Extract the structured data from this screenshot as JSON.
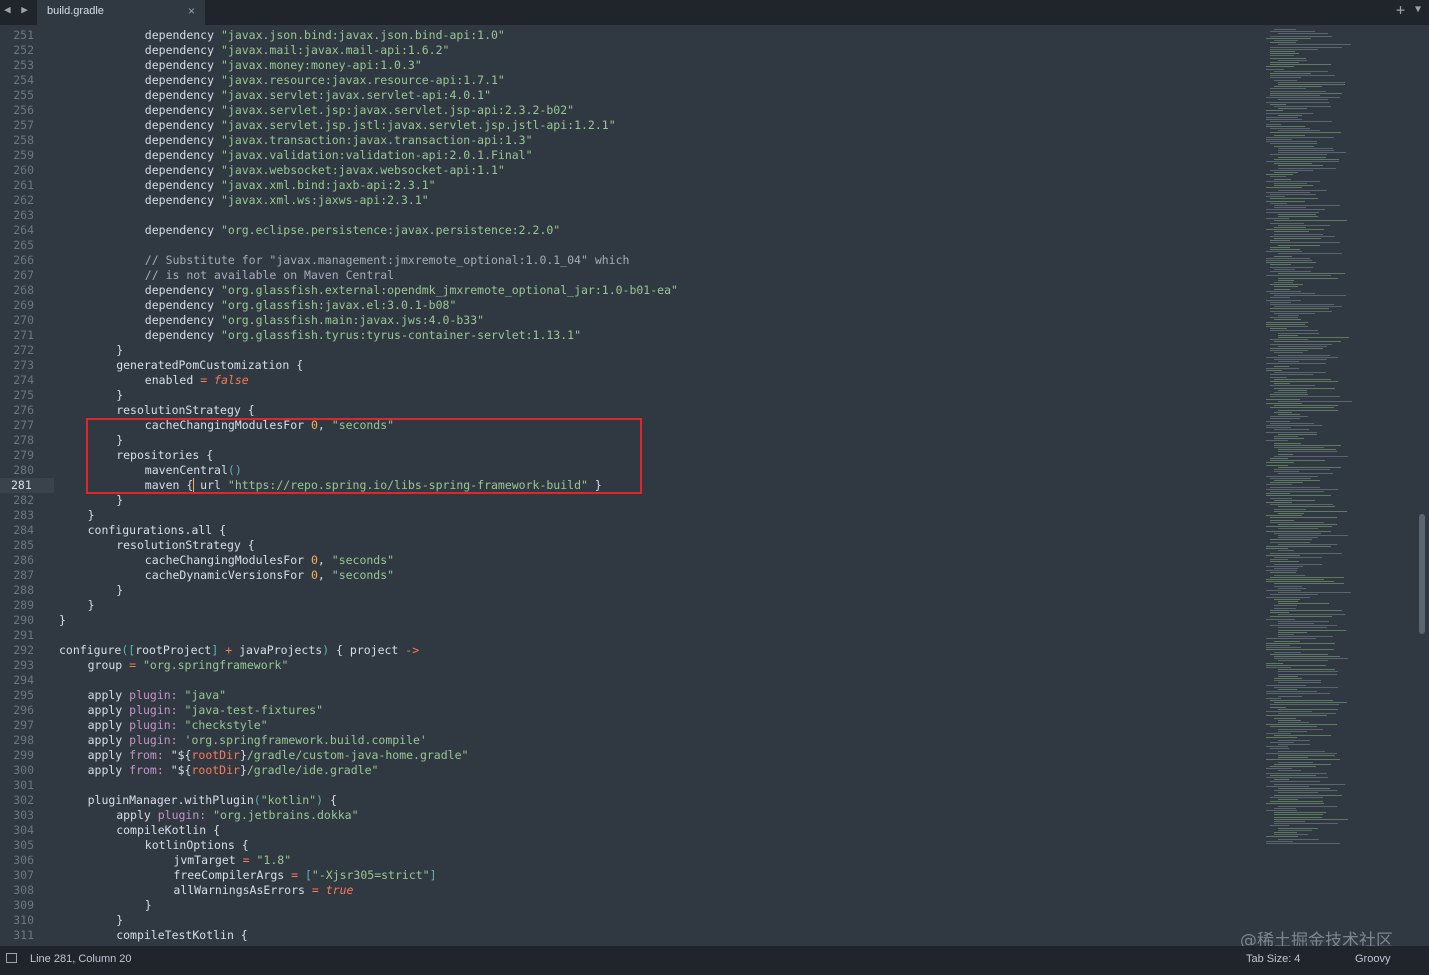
{
  "tab": {
    "filename": "build.gradle",
    "close": "×"
  },
  "tabbar": {
    "nav": "◀ ▶",
    "new_tab": "+",
    "menu": "▼"
  },
  "status": {
    "position": "Line 281, Column 20",
    "tab_size": "Tab Size: 4",
    "syntax": "Groovy"
  },
  "watermark": "@稀土掘金技术社区",
  "editor": {
    "active_line": 281,
    "first_line": 251,
    "lines": [
      [
        [
          4,
          ""
        ],
        [
          "t",
          "dependency "
        ],
        [
          "s",
          "\"javax.json.bind:javax.json.bind-api:1.0\""
        ]
      ],
      [
        [
          4,
          ""
        ],
        [
          "t",
          "dependency "
        ],
        [
          "s",
          "\"javax.mail:javax.mail-api:1.6.2\""
        ]
      ],
      [
        [
          4,
          ""
        ],
        [
          "t",
          "dependency "
        ],
        [
          "s",
          "\"javax.money:money-api:1.0.3\""
        ]
      ],
      [
        [
          4,
          ""
        ],
        [
          "t",
          "dependency "
        ],
        [
          "s",
          "\"javax.resource:javax.resource-api:1.7.1\""
        ]
      ],
      [
        [
          4,
          ""
        ],
        [
          "t",
          "dependency "
        ],
        [
          "s",
          "\"javax.servlet:javax.servlet-api:4.0.1\""
        ]
      ],
      [
        [
          4,
          ""
        ],
        [
          "t",
          "dependency "
        ],
        [
          "s",
          "\"javax.servlet.jsp:javax.servlet.jsp-api:2.3.2-b02\""
        ]
      ],
      [
        [
          4,
          ""
        ],
        [
          "t",
          "dependency "
        ],
        [
          "s",
          "\"javax.servlet.jsp.jstl:javax.servlet.jsp.jstl-api:1.2.1\""
        ]
      ],
      [
        [
          4,
          ""
        ],
        [
          "t",
          "dependency "
        ],
        [
          "s",
          "\"javax.transaction:javax.transaction-api:1.3\""
        ]
      ],
      [
        [
          4,
          ""
        ],
        [
          "t",
          "dependency "
        ],
        [
          "s",
          "\"javax.validation:validation-api:2.0.1.Final\""
        ]
      ],
      [
        [
          4,
          ""
        ],
        [
          "t",
          "dependency "
        ],
        [
          "s",
          "\"javax.websocket:javax.websocket-api:1.1\""
        ]
      ],
      [
        [
          4,
          ""
        ],
        [
          "t",
          "dependency "
        ],
        [
          "s",
          "\"javax.xml.bind:jaxb-api:2.3.1\""
        ]
      ],
      [
        [
          4,
          ""
        ],
        [
          "t",
          "dependency "
        ],
        [
          "s",
          "\"javax.xml.ws:jaxws-api:2.3.1\""
        ]
      ],
      [
        [
          0,
          ""
        ]
      ],
      [
        [
          4,
          ""
        ],
        [
          "t",
          "dependency "
        ],
        [
          "s",
          "\"org.eclipse.persistence:javax.persistence:2.2.0\""
        ]
      ],
      [
        [
          0,
          ""
        ]
      ],
      [
        [
          4,
          ""
        ],
        [
          "c",
          "// Substitute for \"javax.management:jmxremote_optional:1.0.1_04\" which"
        ]
      ],
      [
        [
          4,
          ""
        ],
        [
          "c",
          "// is not available on Maven Central"
        ]
      ],
      [
        [
          4,
          ""
        ],
        [
          "t",
          "dependency "
        ],
        [
          "s",
          "\"org.glassfish.external:opendmk_jmxremote_optional_jar:1.0-b01-ea\""
        ]
      ],
      [
        [
          4,
          ""
        ],
        [
          "t",
          "dependency "
        ],
        [
          "s",
          "\"org.glassfish:javax.el:3.0.1-b08\""
        ]
      ],
      [
        [
          4,
          ""
        ],
        [
          "t",
          "dependency "
        ],
        [
          "s",
          "\"org.glassfish.main:javax.jws:4.0-b33\""
        ]
      ],
      [
        [
          4,
          ""
        ],
        [
          "t",
          "dependency "
        ],
        [
          "s",
          "\"org.glassfish.tyrus:tyrus-container-servlet:1.13.1\""
        ]
      ],
      [
        [
          3,
          ""
        ],
        [
          "t",
          "}"
        ]
      ],
      [
        [
          3,
          ""
        ],
        [
          "t",
          "generatedPomCustomization {"
        ]
      ],
      [
        [
          4,
          ""
        ],
        [
          "t",
          "enabled "
        ],
        [
          "o",
          "= "
        ],
        [
          "b",
          "false"
        ]
      ],
      [
        [
          3,
          ""
        ],
        [
          "t",
          "}"
        ]
      ],
      [
        [
          3,
          ""
        ],
        [
          "t",
          "resolutionStrategy {"
        ]
      ],
      [
        [
          4,
          ""
        ],
        [
          "t",
          "cacheChangingModulesFor "
        ],
        [
          "n",
          "0"
        ],
        [
          "t",
          ", "
        ],
        [
          "s",
          "\"seconds\""
        ]
      ],
      [
        [
          3,
          ""
        ],
        [
          "t",
          "}"
        ]
      ],
      [
        [
          3,
          ""
        ],
        [
          "t",
          "repositories {"
        ]
      ],
      [
        [
          4,
          ""
        ],
        [
          "t",
          "mavenCentral"
        ],
        [
          "p",
          "()"
        ]
      ],
      [
        [
          4,
          ""
        ],
        [
          "t",
          "maven { url "
        ],
        [
          "s",
          "\"https://repo.spring.io/libs-spring-framework-build\""
        ],
        [
          "t",
          " }"
        ]
      ],
      [
        [
          3,
          ""
        ],
        [
          "t",
          "}"
        ]
      ],
      [
        [
          2,
          ""
        ],
        [
          "t",
          "}"
        ]
      ],
      [
        [
          2,
          ""
        ],
        [
          "t",
          "configurations.all {"
        ]
      ],
      [
        [
          3,
          ""
        ],
        [
          "t",
          "resolutionStrategy {"
        ]
      ],
      [
        [
          4,
          ""
        ],
        [
          "t",
          "cacheChangingModulesFor "
        ],
        [
          "n",
          "0"
        ],
        [
          "t",
          ", "
        ],
        [
          "s",
          "\"seconds\""
        ]
      ],
      [
        [
          4,
          ""
        ],
        [
          "t",
          "cacheDynamicVersionsFor "
        ],
        [
          "n",
          "0"
        ],
        [
          "t",
          ", "
        ],
        [
          "s",
          "\"seconds\""
        ]
      ],
      [
        [
          3,
          ""
        ],
        [
          "t",
          "}"
        ]
      ],
      [
        [
          2,
          ""
        ],
        [
          "t",
          "}"
        ]
      ],
      [
        [
          1,
          ""
        ],
        [
          "t",
          "}"
        ]
      ],
      [
        [
          0,
          ""
        ]
      ],
      [
        [
          1,
          ""
        ],
        [
          "t",
          "configure"
        ],
        [
          "p",
          "("
        ],
        [
          "p",
          "["
        ],
        [
          "t",
          "rootProject"
        ],
        [
          "p",
          "]"
        ],
        [
          "t",
          " "
        ],
        [
          "o",
          "+"
        ],
        [
          "t",
          " javaProjects"
        ],
        [
          "p",
          ")"
        ],
        [
          "t",
          " { project "
        ],
        [
          "o",
          "->"
        ]
      ],
      [
        [
          2,
          ""
        ],
        [
          "t",
          "group "
        ],
        [
          "o",
          "= "
        ],
        [
          "s",
          "\"org.springframework\""
        ]
      ],
      [
        [
          0,
          ""
        ]
      ],
      [
        [
          2,
          ""
        ],
        [
          "t",
          "apply "
        ],
        [
          "k",
          "plugin: "
        ],
        [
          "s",
          "\"java\""
        ]
      ],
      [
        [
          2,
          ""
        ],
        [
          "t",
          "apply "
        ],
        [
          "k",
          "plugin: "
        ],
        [
          "s",
          "\"java-test-fixtures\""
        ]
      ],
      [
        [
          2,
          ""
        ],
        [
          "t",
          "apply "
        ],
        [
          "k",
          "plugin: "
        ],
        [
          "s",
          "\"checkstyle\""
        ]
      ],
      [
        [
          2,
          ""
        ],
        [
          "t",
          "apply "
        ],
        [
          "k",
          "plugin: "
        ],
        [
          "s",
          "'org.springframework.build.compile'"
        ]
      ],
      [
        [
          2,
          ""
        ],
        [
          "t",
          "apply "
        ],
        [
          "k",
          "from: "
        ],
        [
          "t",
          "\"${"
        ],
        [
          "o",
          "rootDir"
        ],
        [
          "t",
          "}"
        ],
        [
          "s",
          "/gradle/custom-java-home.gradle\""
        ]
      ],
      [
        [
          2,
          ""
        ],
        [
          "t",
          "apply "
        ],
        [
          "k",
          "from: "
        ],
        [
          "t",
          "\"${"
        ],
        [
          "o",
          "rootDir"
        ],
        [
          "t",
          "}"
        ],
        [
          "s",
          "/gradle/ide.gradle\""
        ]
      ],
      [
        [
          0,
          ""
        ]
      ],
      [
        [
          2,
          ""
        ],
        [
          "t",
          "pluginManager.withPlugin"
        ],
        [
          "p",
          "("
        ],
        [
          "s",
          "\"kotlin\""
        ],
        [
          "p",
          ")"
        ],
        [
          "t",
          " {"
        ]
      ],
      [
        [
          3,
          ""
        ],
        [
          "t",
          "apply "
        ],
        [
          "k",
          "plugin: "
        ],
        [
          "s",
          "\"org.jetbrains.dokka\""
        ]
      ],
      [
        [
          3,
          ""
        ],
        [
          "t",
          "compileKotlin {"
        ]
      ],
      [
        [
          4,
          ""
        ],
        [
          "t",
          "kotlinOptions {"
        ]
      ],
      [
        [
          5,
          ""
        ],
        [
          "t",
          "jvmTarget "
        ],
        [
          "o",
          "= "
        ],
        [
          "s",
          "\"1.8\""
        ]
      ],
      [
        [
          5,
          ""
        ],
        [
          "t",
          "freeCompilerArgs "
        ],
        [
          "o",
          "= "
        ],
        [
          "p",
          "["
        ],
        [
          "s",
          "\"-Xjsr305=strict\""
        ],
        [
          "p",
          "]"
        ]
      ],
      [
        [
          5,
          ""
        ],
        [
          "t",
          "allWarningsAsErrors "
        ],
        [
          "o",
          "= "
        ],
        [
          "b",
          "true"
        ]
      ],
      [
        [
          4,
          ""
        ],
        [
          "t",
          "}"
        ]
      ],
      [
        [
          3,
          ""
        ],
        [
          "t",
          "}"
        ]
      ],
      [
        [
          3,
          ""
        ],
        [
          "t",
          "compileTestKotlin {"
        ]
      ]
    ]
  }
}
